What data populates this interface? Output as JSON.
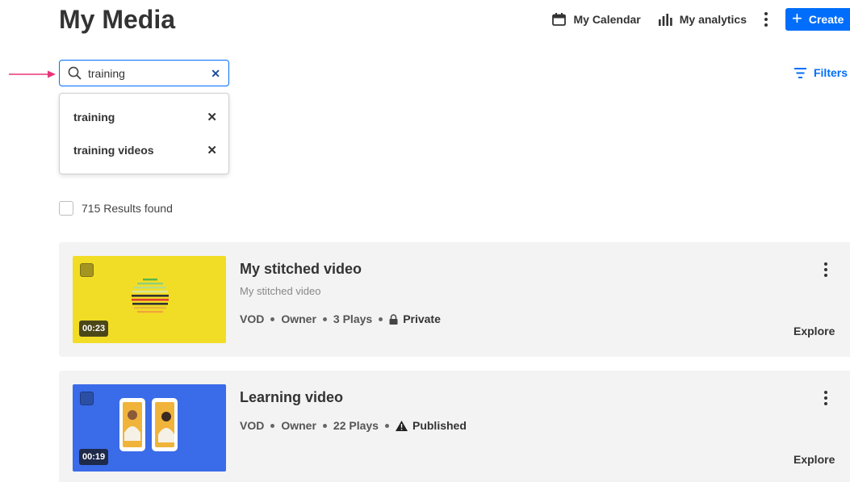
{
  "page": {
    "title": "My Media"
  },
  "header": {
    "calendar_label": "My Calendar",
    "analytics_label": "My analytics",
    "create_label": "Create"
  },
  "search": {
    "value": "training",
    "suggestions": [
      {
        "label": "training"
      },
      {
        "label": "training videos"
      }
    ]
  },
  "filters": {
    "label": "Filters"
  },
  "results": {
    "text": "715 Results found"
  },
  "media": [
    {
      "title": "My stitched video",
      "subtitle": "My stitched video",
      "duration": "00:23",
      "type": "VOD",
      "role": "Owner",
      "plays": "3 Plays",
      "status": "Private",
      "status_icon": "lock-icon",
      "thumb_color": "#f2dd26",
      "explore_label": "Explore"
    },
    {
      "title": "Learning video",
      "duration": "00:19",
      "type": "VOD",
      "role": "Owner",
      "plays": "22 Plays",
      "status": "Published",
      "status_icon": "warning-icon",
      "thumb_color": "#3a6be8",
      "explore_label": "Explore"
    }
  ],
  "colors": {
    "accent": "#006efa",
    "card_bg": "#f3f3f3",
    "arrow": "#e8357a"
  }
}
